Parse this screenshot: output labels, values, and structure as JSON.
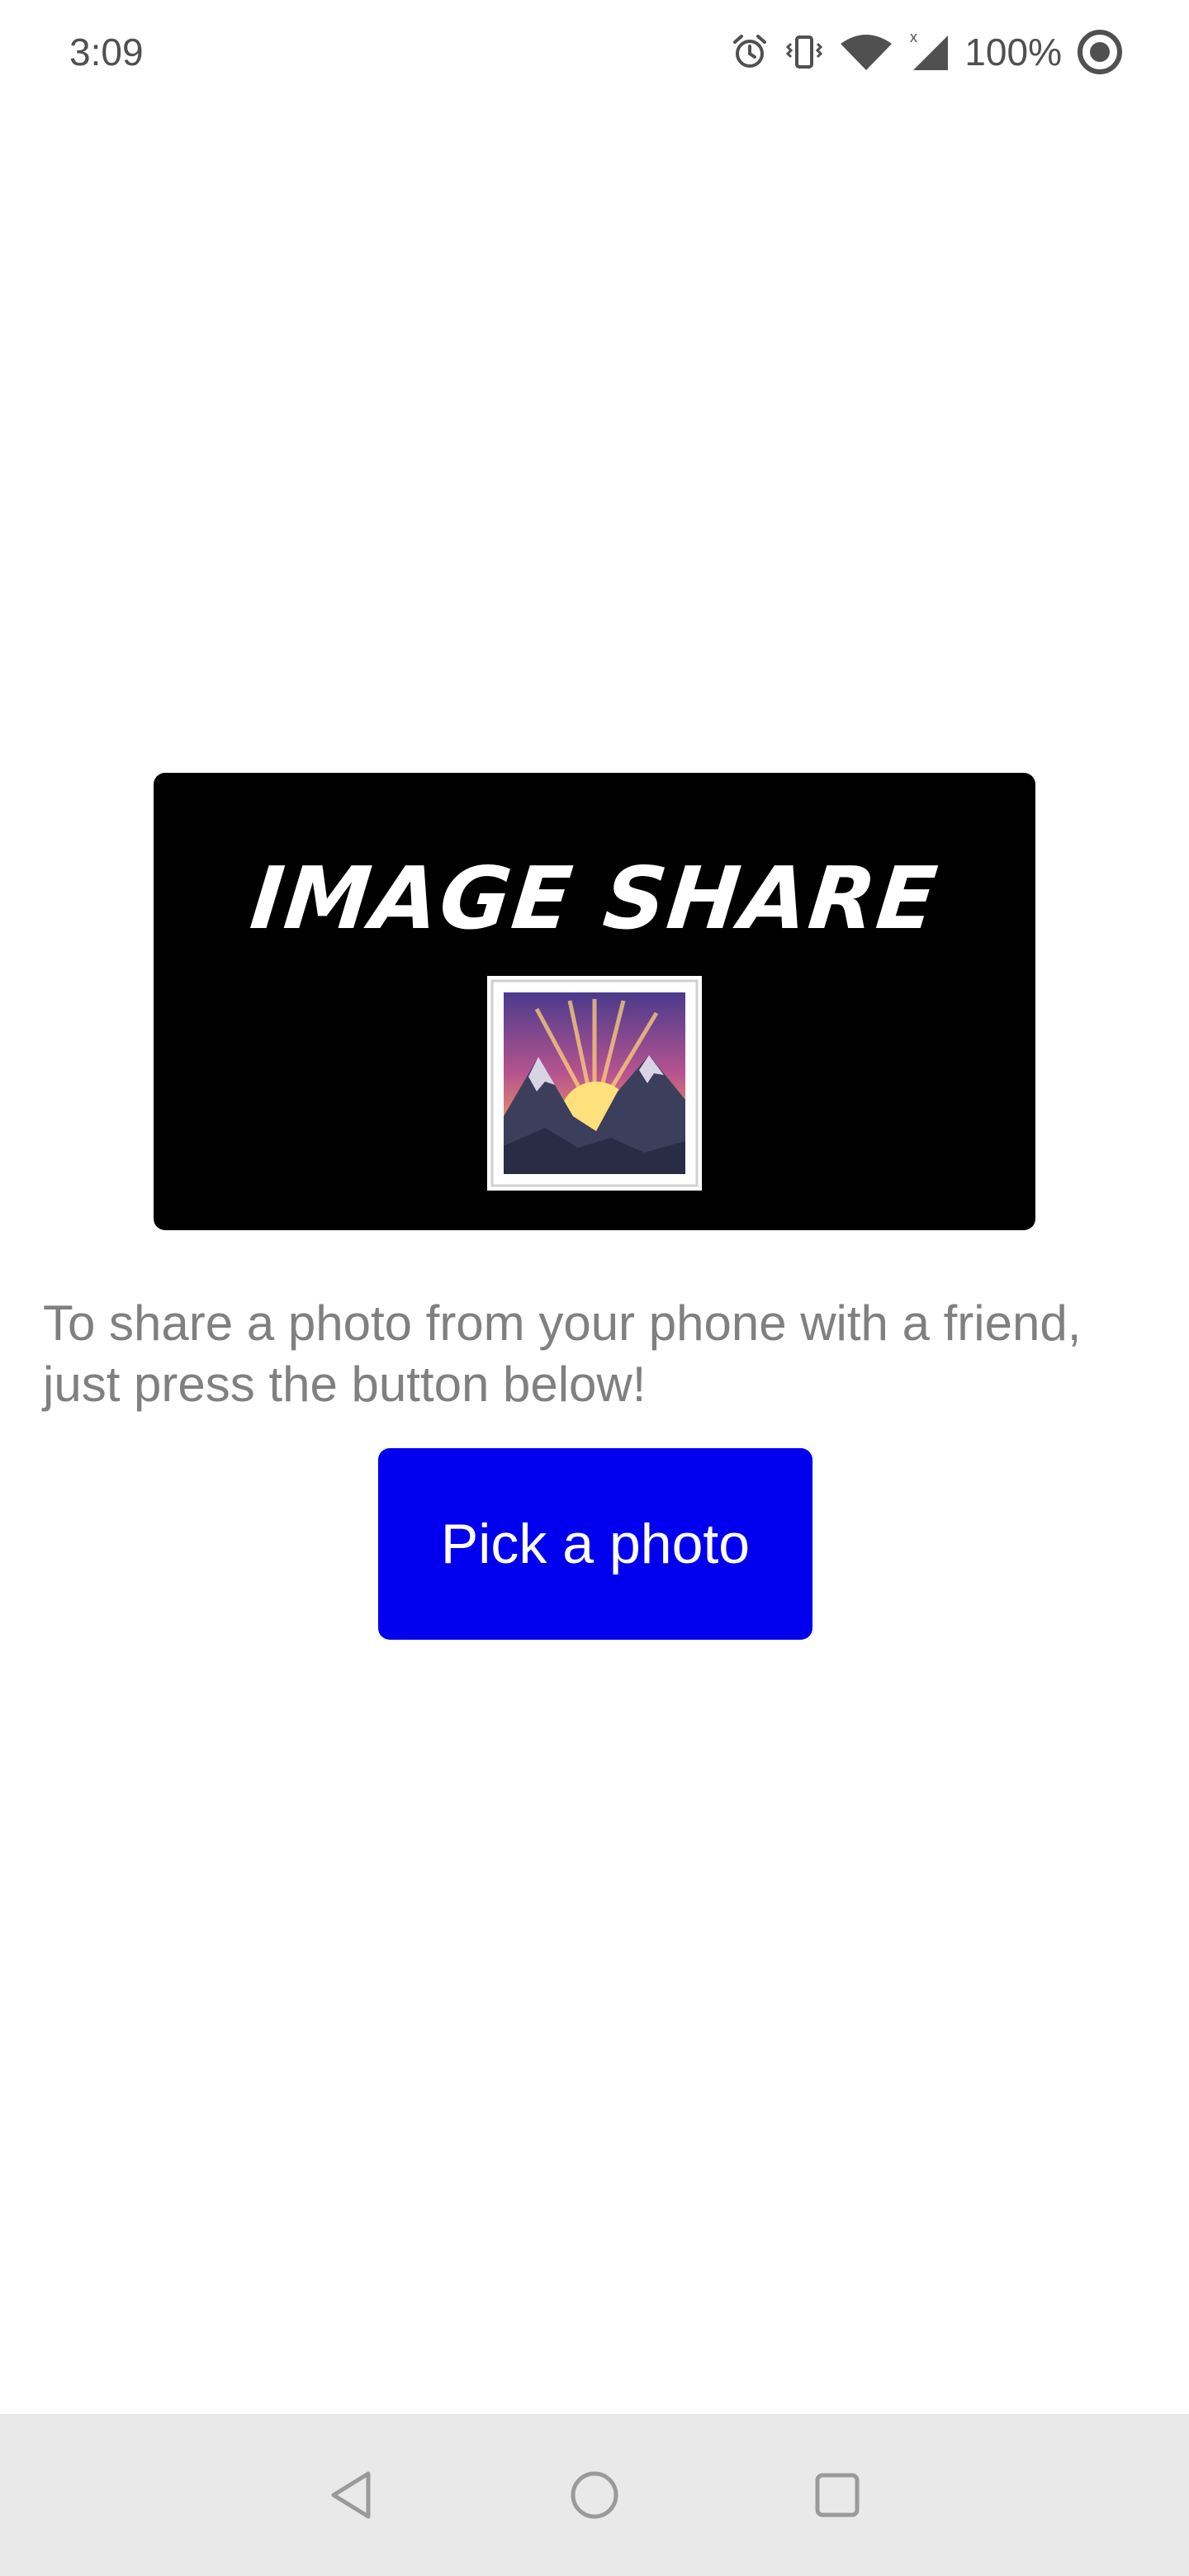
{
  "status_bar": {
    "time": "3:09",
    "battery": "100%",
    "icons": [
      "alarm-icon",
      "vibrate-icon",
      "wifi-icon",
      "cell-signal-icon",
      "battery-saver-icon"
    ]
  },
  "hero": {
    "title": "IMAGE SHARE",
    "image_icon": "sunrise-over-mountains-icon"
  },
  "main": {
    "description": "To share a photo from your phone with a friend, just press the button below!",
    "pick_button_label": "Pick a photo"
  },
  "colors": {
    "button": "#0000ee",
    "hero_background": "#000000",
    "description_text": "#808080",
    "nav_bar": "#e9e9e9"
  },
  "nav_bar": {
    "icons": [
      "back-icon",
      "home-icon",
      "recents-icon"
    ]
  }
}
